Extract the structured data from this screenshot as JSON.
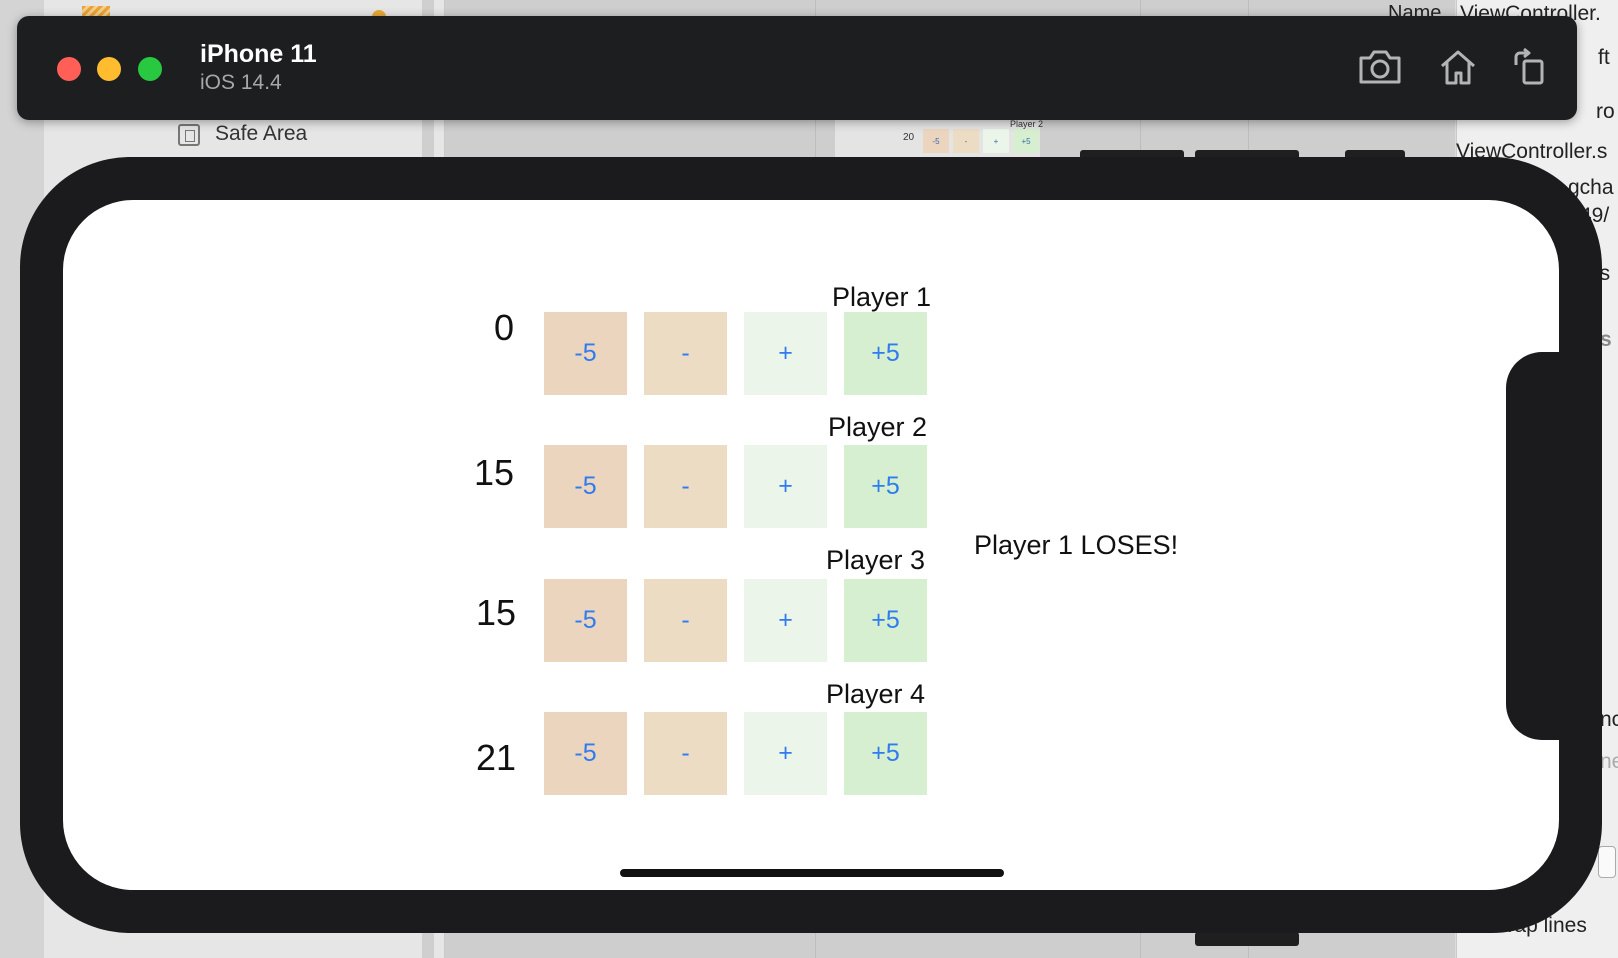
{
  "xcode": {
    "nav_item": "Safe Area",
    "inspector_name_label": "Name",
    "inspector_name_value": "ViewController.",
    "inspector_partial": [
      "ft",
      "ro",
      "ViewController.s",
      "gcha",
      "49/",
      "r.s",
      "s",
      "nc",
      "ne"
    ],
    "wrap_lines": "Wrap lines",
    "preview_player_label": "Player 2",
    "preview_score": "20",
    "preview_buttons": [
      "-5",
      "-",
      "+",
      "+5"
    ]
  },
  "simulator": {
    "device_name": "iPhone 11",
    "os_version": "iOS 14.4",
    "toolbar_icons": [
      "screenshot-icon",
      "home-icon",
      "rotate-icon"
    ]
  },
  "app": {
    "players": [
      {
        "label": "Player 1",
        "score": "0"
      },
      {
        "label": "Player 2",
        "score": "15"
      },
      {
        "label": "Player 3",
        "score": "15"
      },
      {
        "label": "Player 4",
        "score": "21"
      }
    ],
    "buttons": [
      {
        "label": "-5",
        "color": "#ebd5be"
      },
      {
        "label": "-",
        "color": "#eddcc4"
      },
      {
        "label": "+",
        "color": "#ecf5ea"
      },
      {
        "label": "+5",
        "color": "#d5efd0"
      }
    ],
    "button_text_color": "#2f7bf0",
    "status_message": "Player 1 LOSES!"
  }
}
